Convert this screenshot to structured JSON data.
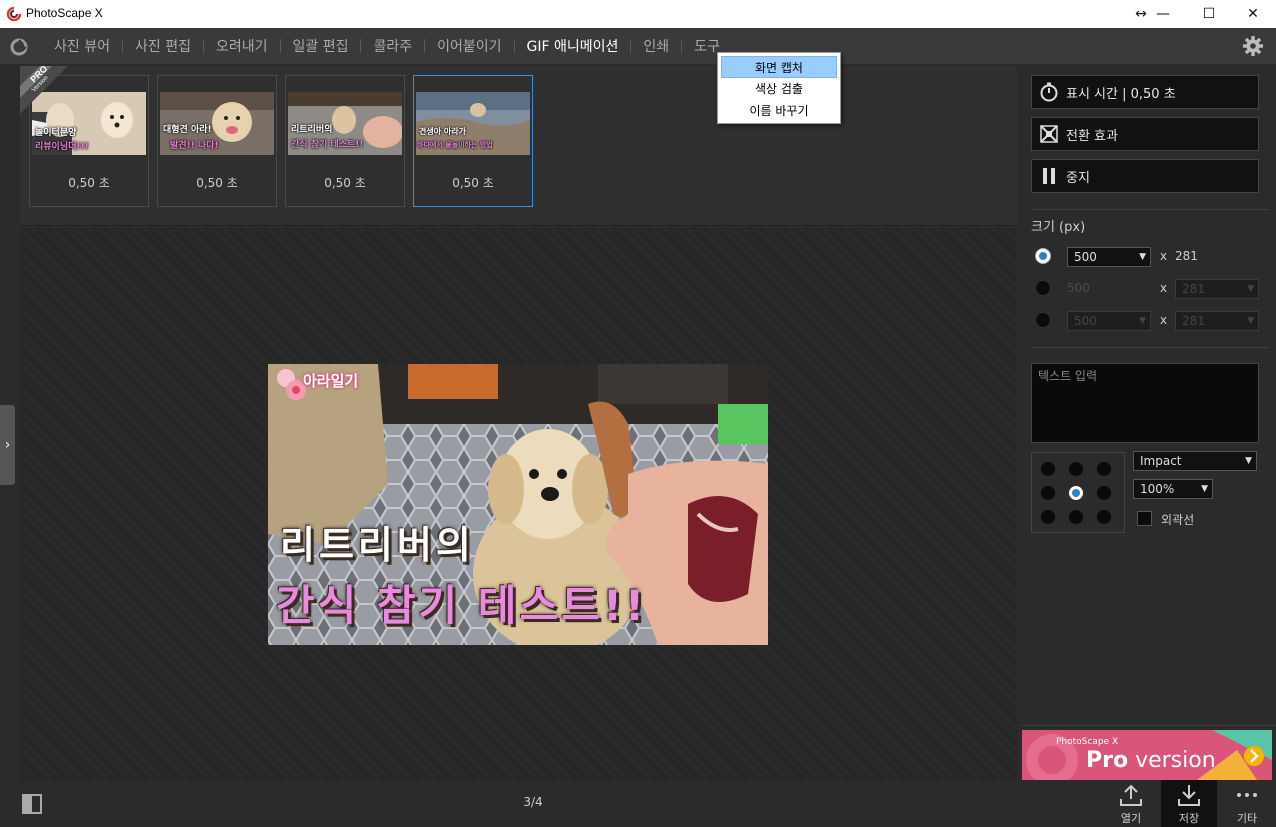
{
  "window": {
    "title": "PhotoScape X",
    "controls": {
      "resize": "↔",
      "minimize": "—",
      "maximize": "☐",
      "close": "✕"
    }
  },
  "menu": {
    "items": [
      {
        "label": "사진 뷰어",
        "active": false
      },
      {
        "label": "사진 편집",
        "active": false
      },
      {
        "label": "오려내기",
        "active": false
      },
      {
        "label": "일괄 편집",
        "active": false
      },
      {
        "label": "콜라주",
        "active": false
      },
      {
        "label": "이어붙이기",
        "active": false
      },
      {
        "label": "GIF 애니메이션",
        "active": true
      },
      {
        "label": "인쇄",
        "active": false
      },
      {
        "label": "도구",
        "active": false
      }
    ],
    "tools_dropdown": [
      {
        "label": "화면 캡처",
        "highlighted": true
      },
      {
        "label": "색상 검출",
        "highlighted": false
      },
      {
        "label": "이름 바꾸기",
        "highlighted": false
      }
    ]
  },
  "pro_badge": {
    "line1": "PRO",
    "line2": "Version"
  },
  "frames": [
    {
      "duration": "0,50 초",
      "caption_top": "놀이터분양",
      "caption_bottom": "리뷰이닝더!!!",
      "selected": false
    },
    {
      "duration": "0,50 초",
      "caption_top": "대형견 아라!",
      "caption_bottom": "발견!! 나다!",
      "selected": false
    },
    {
      "duration": "0,50 초",
      "caption_top": "리트리버의",
      "caption_bottom": "간식 참기 테스트!!",
      "selected": false
    },
    {
      "duration": "0,50 초",
      "caption_top": "견생아 아라가",
      "caption_bottom": "바다에서 물놀이하는 방법",
      "selected": true
    }
  ],
  "preview": {
    "watermark": "아라일기",
    "line1": "리트리버의",
    "line2": "간식 참기 테스트!!"
  },
  "right_panel": {
    "display_time_button": "표시 시간 | 0,50 초",
    "transition_button": "전환 효과",
    "stop_button": "중지",
    "size_label": "크기 (px)",
    "size_rows": [
      {
        "selected": true,
        "width": "500",
        "x": "x",
        "height": "281",
        "enabled": true
      },
      {
        "selected": false,
        "width": "500",
        "x": "x",
        "height": "281",
        "enabled": false
      },
      {
        "selected": false,
        "width": "500",
        "x": "x",
        "height": "281",
        "enabled": false
      }
    ],
    "text_placeholder": "텍스트 입력",
    "font": "Impact",
    "scale": "100%",
    "outline_label": "외곽선",
    "outline_checked": false
  },
  "pro_banner": {
    "brand": "PhotoScape X",
    "text_pro": "Pro",
    "text_version": " version"
  },
  "bottom": {
    "page_indicator": "3/4",
    "open_label": "열기",
    "save_label": "저장",
    "more_label": "기타"
  },
  "colors": {
    "accent": "#2d7fd0",
    "selected_border": "#3e8ede",
    "banner_pink": "#d9567a"
  }
}
